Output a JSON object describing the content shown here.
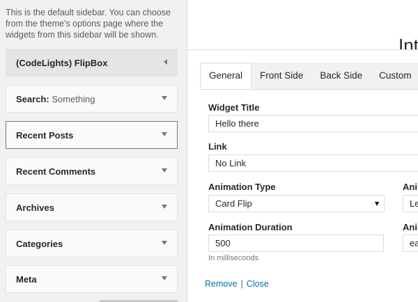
{
  "sidebar": {
    "description": "This is the default sidebar. You can choose from the theme's options page where the widgets from this sidebar will be shown.",
    "widgets": [
      {
        "title": "(CodeLights) FlipBox",
        "in_title": ""
      },
      {
        "title": "Search:",
        "in_title": "Something"
      },
      {
        "title": "Recent Posts",
        "in_title": ""
      },
      {
        "title": "Recent Comments",
        "in_title": ""
      },
      {
        "title": "Archives",
        "in_title": ""
      },
      {
        "title": "Categories",
        "in_title": ""
      },
      {
        "title": "Meta",
        "in_title": ""
      }
    ]
  },
  "peek_heading": "Int",
  "editor": {
    "tabs": [
      "General",
      "Front Side",
      "Back Side",
      "Custom"
    ],
    "active_tab": "General",
    "fields": {
      "widget_title": {
        "label": "Widget Title",
        "value": "Hello there"
      },
      "link": {
        "label": "Link",
        "value": "No Link"
      },
      "animation_type": {
        "label": "Animation Type",
        "value": "Card Flip"
      },
      "animation_duration": {
        "label": "Animation Duration",
        "value": "500",
        "hint": "In milliseconds"
      },
      "right_col_label_1": "Anim",
      "right_col_value_1": "Le",
      "right_col_label_2": "Anim",
      "right_col_value_2": "ea"
    },
    "actions": {
      "remove": "Remove",
      "separator": "|",
      "close": "Close"
    }
  },
  "colors": {
    "link": "#0073aa",
    "panel_bg": "#f1f1f1"
  }
}
